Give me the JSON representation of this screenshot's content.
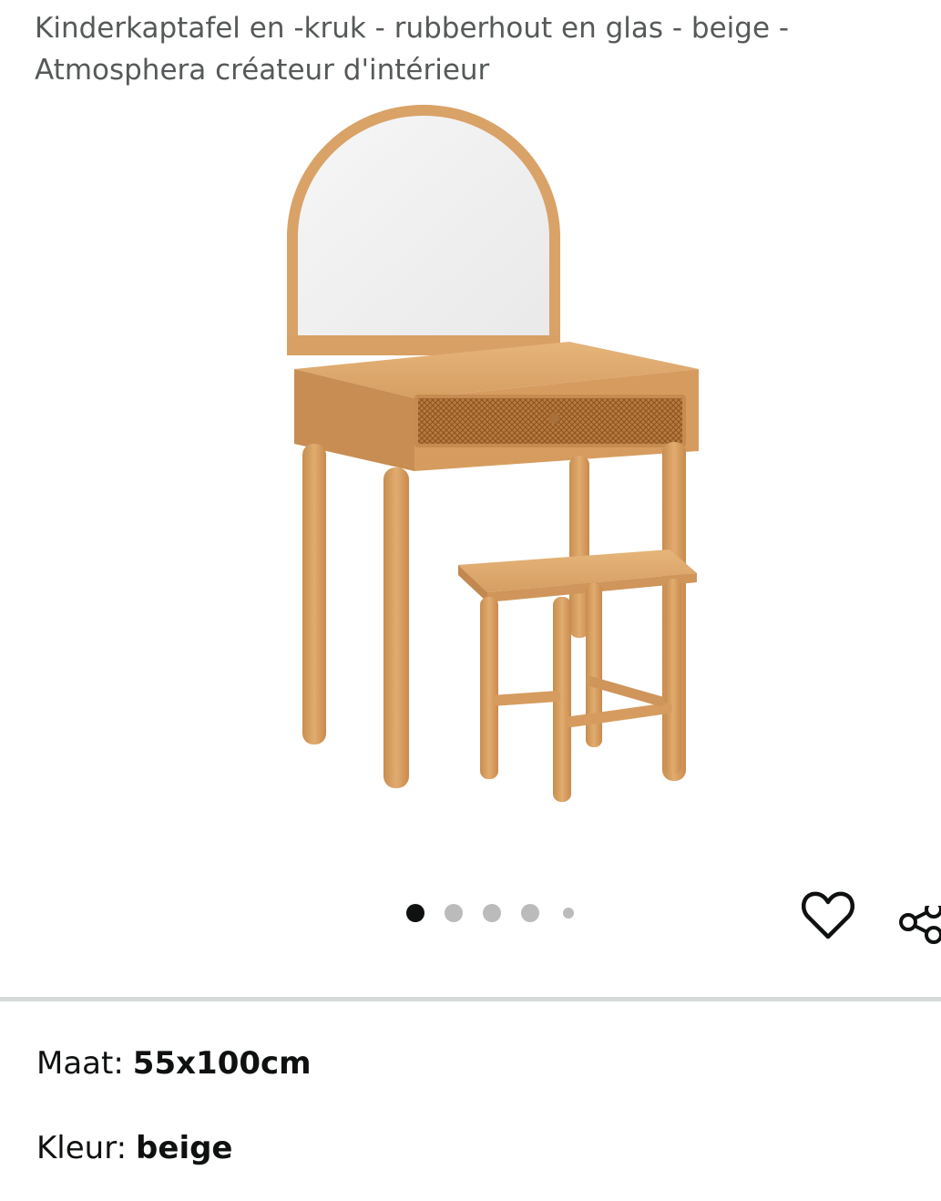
{
  "product": {
    "title": "Kinderkaptafel en -kruk - rubberhout en glas - beige - Atmosphera créateur d'intérieur",
    "image_icon": "vanity-table-with-stool-photo"
  },
  "carousel": {
    "dots": [
      {
        "active": true
      },
      {
        "active": false
      },
      {
        "active": false
      },
      {
        "active": false
      },
      {
        "active": false,
        "small": true
      }
    ],
    "active_color": "#0f1111",
    "inactive_color": "#bbbbbb"
  },
  "actions": {
    "favorite_icon": "heart-icon",
    "share_icon": "share-icon"
  },
  "variations": {
    "size_label": "Maat:",
    "size_value": "55x100cm",
    "color_label": "Kleur:",
    "color_value": "beige"
  }
}
